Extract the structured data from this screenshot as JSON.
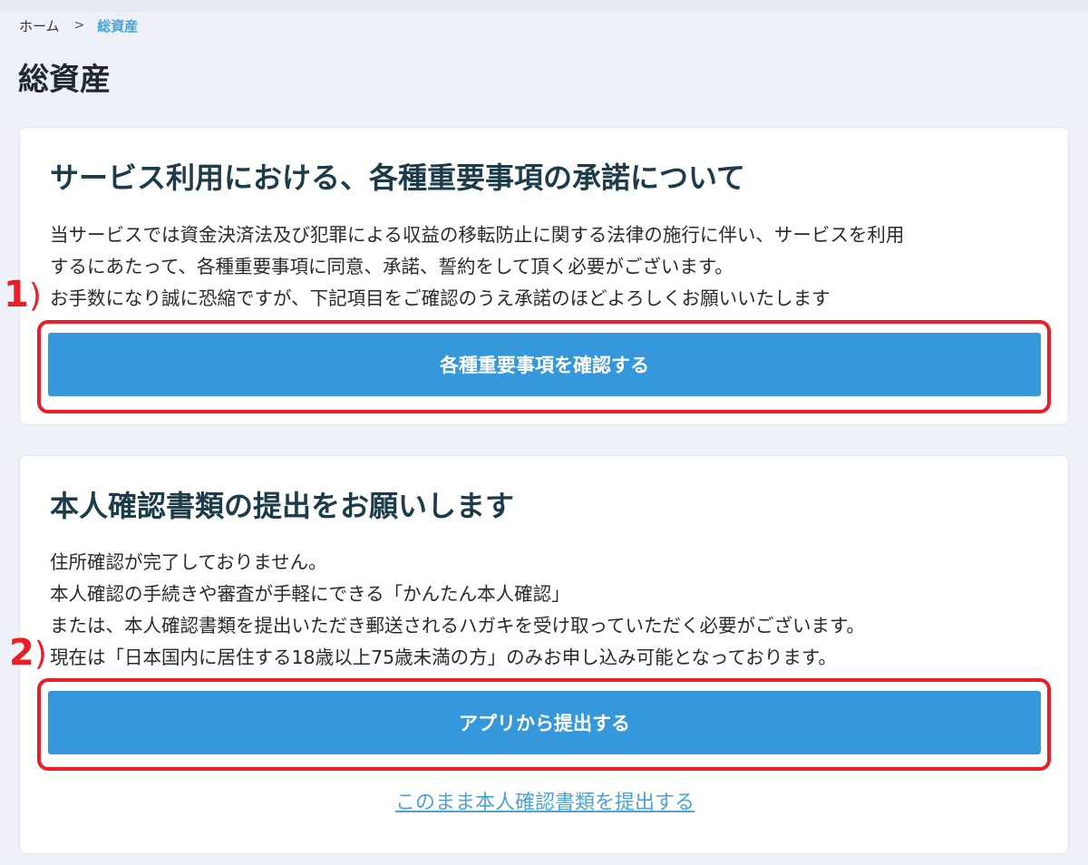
{
  "breadcrumb": {
    "home": "ホーム",
    "separator": ">",
    "current": "総資産"
  },
  "page": {
    "title": "総資産"
  },
  "card_terms": {
    "heading": "サービス利用における、各種重要事項の承諾について",
    "body_lines": [
      "当サービスでは資金決済法及び犯罪による収益の移転防止に関する法律の施行に伴い、サービスを利用",
      "するにあたって、各種重要事項に同意、承諾、誓約をして頂く必要がございます。",
      "お手数になり誠に恐縮ですが、下記項目をご確認のうえ承諾のほどよろしくお願いいたします"
    ],
    "button_label": "各種重要事項を確認する"
  },
  "card_identity": {
    "heading": "本人確認書類の提出をお願いします",
    "body_lines": [
      "住所確認が完了しておりません。",
      "本人確認の手続きや審査が手軽にできる「かんたん本人確認」",
      "または、本人確認書類を提出いただき郵送されるハガキを受け取っていただく必要がございます。",
      "現在は「日本国内に居住する18歳以上75歳未満の方」のみお申し込み可能となっております。"
    ],
    "button_label": "アプリから提出する",
    "link_label": "このまま本人確認書類を提出する"
  },
  "annotations": {
    "first": {
      "number": "1",
      "paren": ")"
    },
    "second": {
      "number": "2",
      "paren": ")"
    }
  },
  "colors": {
    "background": "#eef1f7",
    "accent": "#3498db",
    "link": "#4ba3d8",
    "heading": "#1c3c4a",
    "annotation": "#ee1c24"
  }
}
